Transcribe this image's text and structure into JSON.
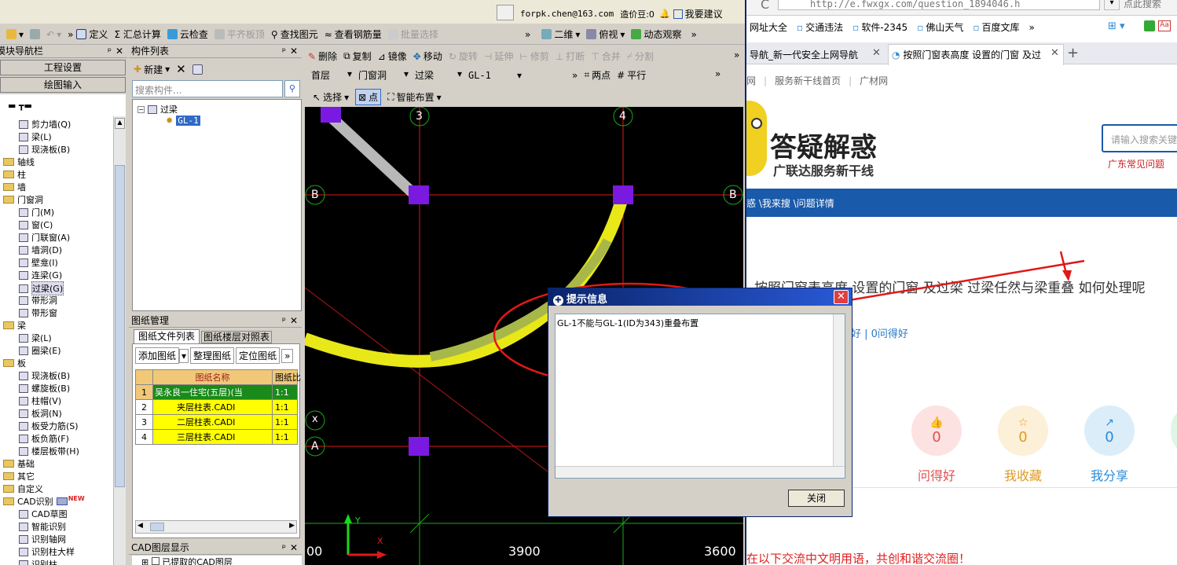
{
  "top_bar": {
    "email": "forpk.chen@163.com",
    "beans": "造价豆:0",
    "suggest": "我要建议"
  },
  "toolbar1": {
    "define": "定义",
    "summary": "Σ 汇总计算",
    "cloud_check": "云检查",
    "flatten": "平齐板顶",
    "find": "查找图元",
    "view_rebar": "查看钢筋量",
    "batch_select": "批量选择",
    "view2d": "二维",
    "top_view": "俯视",
    "dynamic": "动态观察"
  },
  "toolbar2": {
    "delete": "删除",
    "copy": "复制",
    "mirror": "镜像",
    "move": "移动",
    "rotate": "旋转",
    "extend": "延伸",
    "trim": "修剪",
    "break": "打断",
    "merge": "合并",
    "split": "分割"
  },
  "toolbar3": {
    "floor": "首层",
    "category": "门窗洞",
    "type": "过梁",
    "component": "GL-1",
    "two_point": "两点",
    "parallel": "平行"
  },
  "toolbar4": {
    "select": "选择",
    "point": "点",
    "smart_layout": "智能布置"
  },
  "nav": {
    "title": "模块导航栏",
    "project_settings": "工程设置",
    "drawing_input": "绘图输入",
    "items": [
      {
        "label": "剪力墙(Q)",
        "level": 2
      },
      {
        "label": "梁(L)",
        "level": 2
      },
      {
        "label": "现浇板(B)",
        "level": 2
      },
      {
        "label": "轴线",
        "level": 1
      },
      {
        "label": "柱",
        "level": 1
      },
      {
        "label": "墙",
        "level": 1
      },
      {
        "label": "门窗洞",
        "level": 1
      },
      {
        "label": "门(M)",
        "level": 2
      },
      {
        "label": "窗(C)",
        "level": 2
      },
      {
        "label": "门联窗(A)",
        "level": 2
      },
      {
        "label": "墙洞(D)",
        "level": 2
      },
      {
        "label": "壁龛(I)",
        "level": 2
      },
      {
        "label": "连梁(G)",
        "level": 2
      },
      {
        "label": "过梁(G)",
        "level": 2,
        "selected": true
      },
      {
        "label": "带形洞",
        "level": 2
      },
      {
        "label": "带形窗",
        "level": 2
      },
      {
        "label": "梁",
        "level": 1
      },
      {
        "label": "梁(L)",
        "level": 2
      },
      {
        "label": "圈梁(E)",
        "level": 2
      },
      {
        "label": "板",
        "level": 1
      },
      {
        "label": "现浇板(B)",
        "level": 2
      },
      {
        "label": "螺旋板(B)",
        "level": 2
      },
      {
        "label": "柱帽(V)",
        "level": 2
      },
      {
        "label": "板洞(N)",
        "level": 2
      },
      {
        "label": "板受力筋(S)",
        "level": 2
      },
      {
        "label": "板负筋(F)",
        "level": 2
      },
      {
        "label": "楼层板带(H)",
        "level": 2
      },
      {
        "label": "基础",
        "level": 1
      },
      {
        "label": "其它",
        "level": 1
      },
      {
        "label": "自定义",
        "level": 1
      },
      {
        "label": "CAD识别",
        "level": 1,
        "badge": "NEW"
      },
      {
        "label": "CAD草图",
        "level": 2
      },
      {
        "label": "智能识别",
        "level": 2
      },
      {
        "label": "识别轴网",
        "level": 2
      },
      {
        "label": "识别柱大样",
        "level": 2
      },
      {
        "label": "识别柱",
        "level": 2
      }
    ]
  },
  "component_list": {
    "title": "构件列表",
    "new_label": "新建",
    "search_placeholder": "搜索构件...",
    "root": "过梁",
    "child": "GL-1"
  },
  "drawing_mgmt": {
    "title": "图纸管理",
    "tab1": "图纸文件列表",
    "tab2": "图纸楼层对照表",
    "add": "添加图纸",
    "organize": "整理图纸",
    "locate": "定位图纸",
    "col_name": "图纸名称",
    "col_ratio": "图纸比",
    "rows": [
      {
        "n": "1",
        "name": "吴永良一住宅(五层)(当",
        "ratio": "1:1"
      },
      {
        "n": "2",
        "name": "夹层柱表.CADI",
        "ratio": "1:1"
      },
      {
        "n": "3",
        "name": "二层柱表.CADI",
        "ratio": "1:1"
      },
      {
        "n": "4",
        "name": "三层柱表.CADI",
        "ratio": "1:1"
      }
    ]
  },
  "cad_layer": {
    "title": "CAD图层显示",
    "item": "已提取的CAD图层"
  },
  "canvas": {
    "axis_3": "3",
    "axis_4": "4",
    "axis_B": "B",
    "axis_A": "A",
    "axis_x": "x",
    "dim_left": "00",
    "dim_mid": "3900",
    "dim_right": "3600",
    "y_label": "Y",
    "x_label": "X"
  },
  "dialog": {
    "title": "提示信息",
    "message": "GL-1不能与GL-1(ID为343)重叠布置",
    "close": "关闭"
  },
  "browser": {
    "url": "http://e.fwxgx.com/question_1894046.h",
    "search_hint": "点此搜索",
    "bookmarks": [
      "网址大全",
      "交通违法",
      "软件-2345",
      "佛山天气",
      "百度文库"
    ],
    "tab1": "导航_新一代安全上网导航",
    "tab2": "按照门窗表高度 设置的门窗 及过",
    "sub_links": [
      "网",
      "服务新干线首页",
      "广材网"
    ],
    "logo_title": "答疑解惑",
    "logo_sub": "广联达服务新干线",
    "search_placeholder": "请输入搜索关键",
    "guangdong": "广东常见问题",
    "crumb": "惑 \\我来搜 \\问题详情",
    "question": "按照门窗表高度 设置的门窗 及过梁 过梁任然与梁重叠 如何处理呢",
    "likes": "得好 | 0问得好",
    "stats": [
      {
        "label": "问得好",
        "value": "0",
        "color": "#e05050"
      },
      {
        "label": "我收藏",
        "value": "0",
        "color": "#e09a20"
      },
      {
        "label": "我分享",
        "value": "0",
        "color": "#2a8ad8"
      }
    ],
    "footer": "在以下交流中文明用语，共创和谐交流圈！"
  }
}
